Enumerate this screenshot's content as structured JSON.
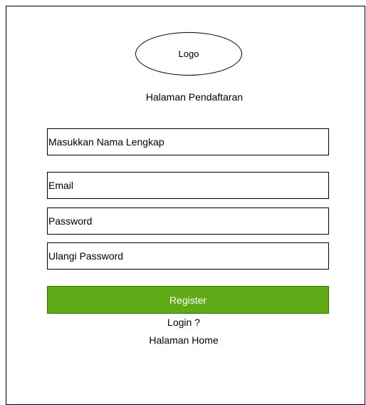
{
  "logo": {
    "label": "Logo"
  },
  "page": {
    "title": "Halaman Pendaftaran"
  },
  "form": {
    "fields": [
      {
        "placeholder": "Masukkan Nama Lengkap"
      },
      {
        "placeholder": "Email"
      },
      {
        "placeholder": "Password"
      },
      {
        "placeholder": "Ulangi Password"
      }
    ],
    "register_label": "Register",
    "login_link": "Login ?",
    "home_link": "Halaman Home"
  },
  "colors": {
    "register_fill": "#60a917",
    "register_border": "#2d7600",
    "register_text": "#ffffff"
  }
}
